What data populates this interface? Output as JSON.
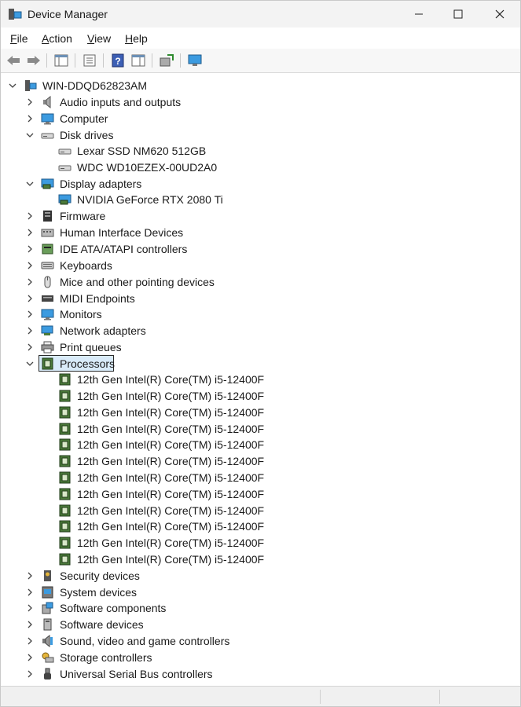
{
  "window": {
    "title": "Device Manager"
  },
  "menu": [
    {
      "key": "F",
      "rest": "ile"
    },
    {
      "key": "A",
      "rest": "ction"
    },
    {
      "key": "V",
      "rest": "iew"
    },
    {
      "key": "H",
      "rest": "elp"
    }
  ],
  "tree": {
    "root": "WIN-DDQD62823AM",
    "categories": {
      "audio": "Audio inputs and outputs",
      "computer": "Computer",
      "disk": "Disk drives",
      "disk_children": [
        "Lexar SSD NM620 512GB",
        "WDC WD10EZEX-00UD2A0"
      ],
      "display": "Display adapters",
      "display_children": [
        "NVIDIA GeForce RTX 2080 Ti"
      ],
      "firmware": "Firmware",
      "hid": "Human Interface Devices",
      "ide": "IDE ATA/ATAPI controllers",
      "keyboards": "Keyboards",
      "mice": "Mice and other pointing devices",
      "midi": "MIDI Endpoints",
      "monitors": "Monitors",
      "network": "Network adapters",
      "print": "Print queues",
      "processors": "Processors",
      "processor_children": [
        "12th Gen Intel(R) Core(TM) i5-12400F",
        "12th Gen Intel(R) Core(TM) i5-12400F",
        "12th Gen Intel(R) Core(TM) i5-12400F",
        "12th Gen Intel(R) Core(TM) i5-12400F",
        "12th Gen Intel(R) Core(TM) i5-12400F",
        "12th Gen Intel(R) Core(TM) i5-12400F",
        "12th Gen Intel(R) Core(TM) i5-12400F",
        "12th Gen Intel(R) Core(TM) i5-12400F",
        "12th Gen Intel(R) Core(TM) i5-12400F",
        "12th Gen Intel(R) Core(TM) i5-12400F",
        "12th Gen Intel(R) Core(TM) i5-12400F",
        "12th Gen Intel(R) Core(TM) i5-12400F"
      ],
      "security": "Security devices",
      "system": "System devices",
      "sw_components": "Software components",
      "sw_devices": "Software devices",
      "sound": "Sound, video and game controllers",
      "storage": "Storage controllers",
      "usb": "Universal Serial Bus controllers"
    },
    "selected": "Processors"
  },
  "colors": {
    "selection": "#d9ebf9",
    "monitor_blue": "#3c9be0",
    "chip_green": "#4b7a3a"
  }
}
